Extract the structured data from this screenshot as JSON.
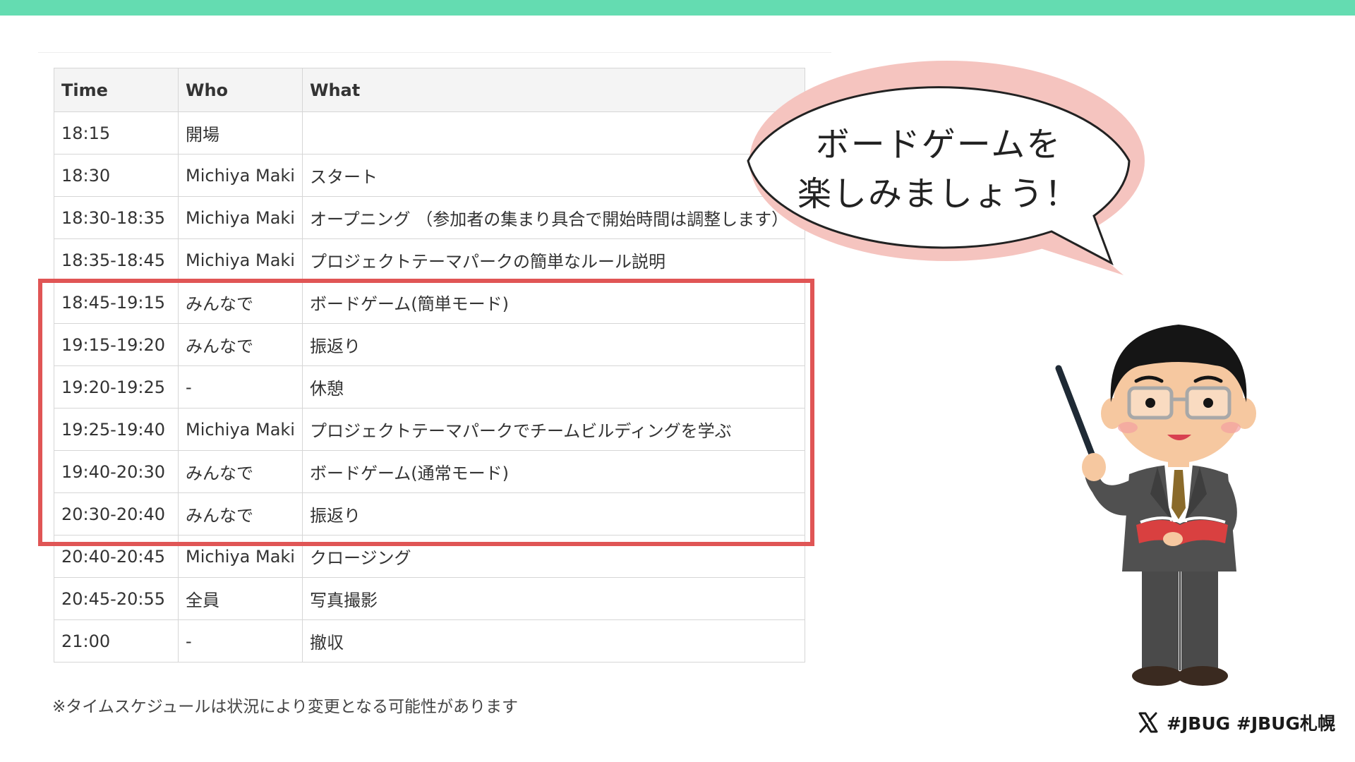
{
  "colors": {
    "accent_bar": "#64dcb1",
    "highlight_border": "#e05555",
    "bubble_shadow": "#f5c4bf"
  },
  "table": {
    "headers": {
      "time": "Time",
      "who": "Who",
      "what": "What"
    },
    "rows": [
      {
        "time": "18:15",
        "who": "開場",
        "what": ""
      },
      {
        "time": "18:30",
        "who": "Michiya Maki",
        "what": "スタート"
      },
      {
        "time": "18:30-18:35",
        "who": "Michiya Maki",
        "what": "オープニング （参加者の集まり具合で開始時間は調整します）"
      },
      {
        "time": "18:35-18:45",
        "who": "Michiya Maki",
        "what": "プロジェクトテーマパークの簡単なルール説明"
      },
      {
        "time": "18:45-19:15",
        "who": "みんなで",
        "what": "ボードゲーム(簡単モード)"
      },
      {
        "time": "19:15-19:20",
        "who": "みんなで",
        "what": "振返り"
      },
      {
        "time": "19:20-19:25",
        "who": "-",
        "what": "休憩"
      },
      {
        "time": "19:25-19:40",
        "who": "Michiya Maki",
        "what": "プロジェクトテーマパークでチームビルディングを学ぶ"
      },
      {
        "time": "19:40-20:30",
        "who": "みんなで",
        "what": "ボードゲーム(通常モード)"
      },
      {
        "time": "20:30-20:40",
        "who": "みんなで",
        "what": "振返り"
      },
      {
        "time": "20:40-20:45",
        "who": "Michiya Maki",
        "what": "クロージング"
      },
      {
        "time": "20:45-20:55",
        "who": "全員",
        "what": "写真撮影"
      },
      {
        "time": "21:00",
        "who": "-",
        "what": "撤収"
      }
    ]
  },
  "footnote": "※タイムスケジュールは状況により変更となる可能性があります",
  "bubble": {
    "line1": "ボードゲームを",
    "line2": "楽しみましょう！"
  },
  "icons": {
    "social": "x-logo-icon",
    "illustration": "teacher-with-pointer-icon"
  },
  "hashtags": "#JBUG #JBUG札幌"
}
